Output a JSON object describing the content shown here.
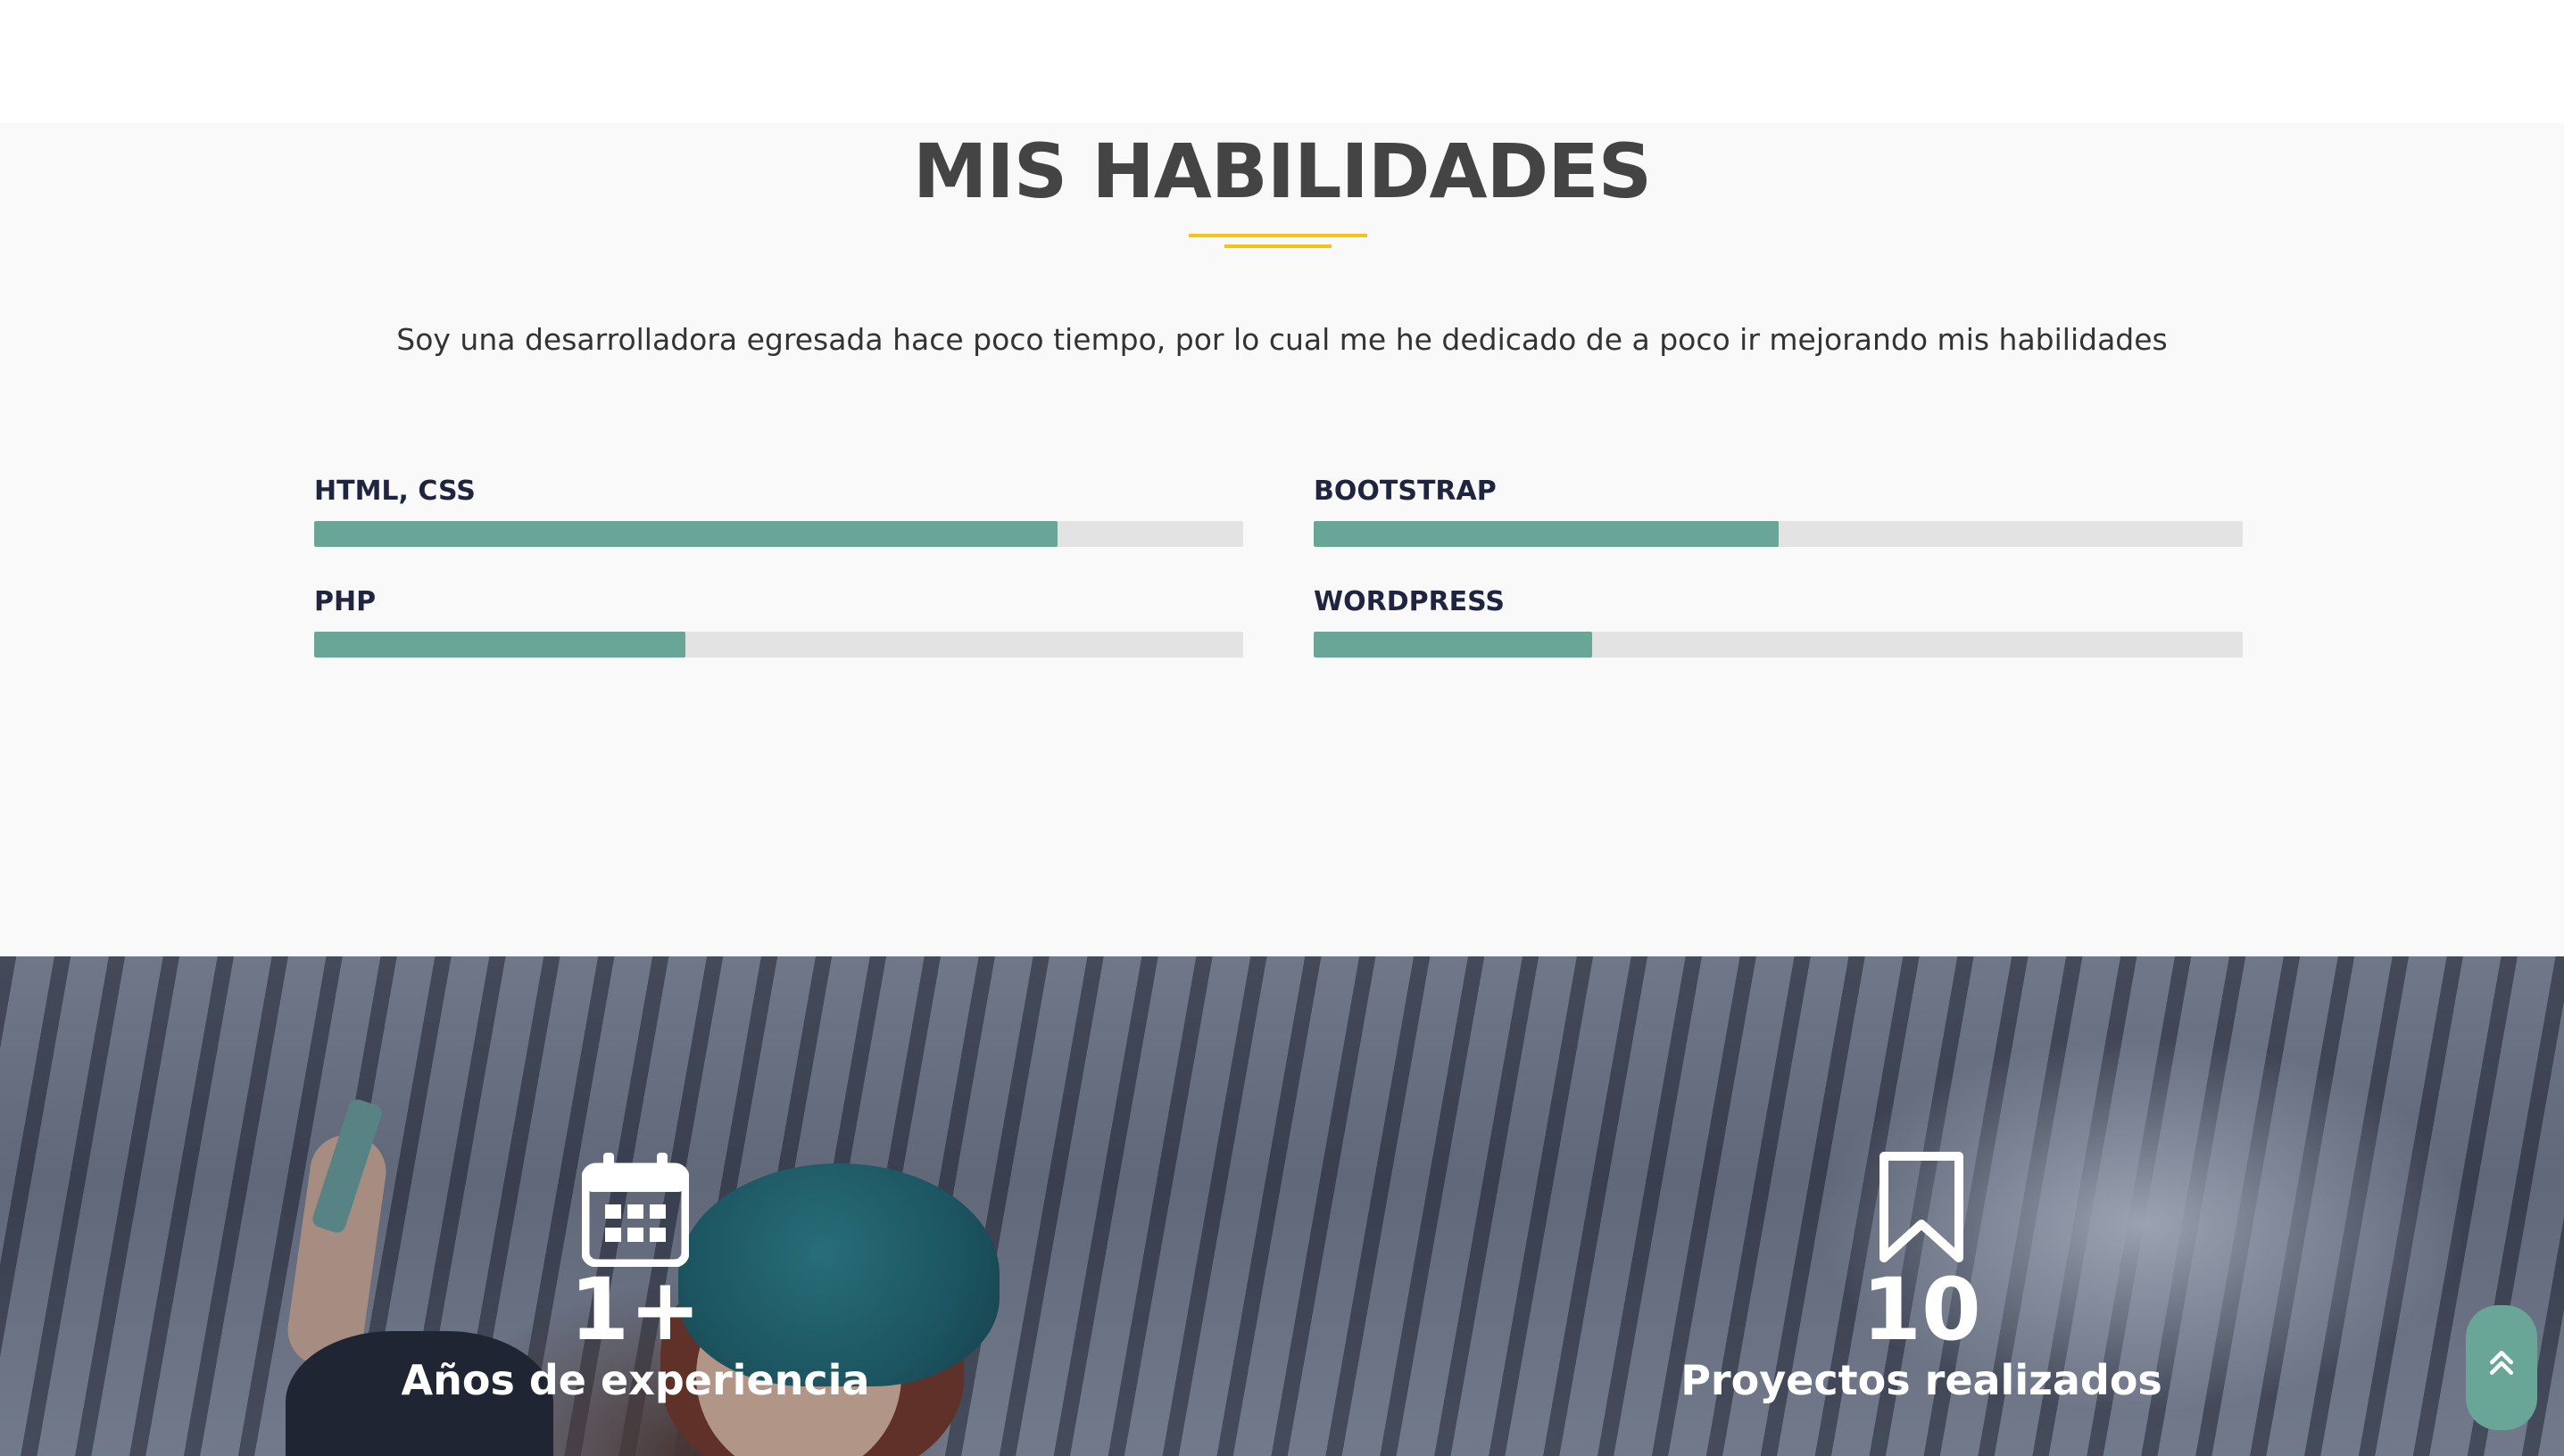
{
  "skills": {
    "title": "MIS HABILIDADES",
    "intro": "Soy una desarrolladora egresada hace poco tiempo, por lo cual me he dedicado de a poco ir mejorando mis habilidades",
    "items": [
      {
        "label": "HTML, CSS",
        "level_percent": 80
      },
      {
        "label": "BOOTSTRAP",
        "level_percent": 50
      },
      {
        "label": "PHP",
        "level_percent": 40
      },
      {
        "label": "WORDPRESS",
        "level_percent": 30
      }
    ],
    "colors": {
      "fill": "#6aa698",
      "track": "#e3e3e3",
      "accent": "#f0c419"
    }
  },
  "stats": [
    {
      "icon": "calendar-icon",
      "number": "1+",
      "label": "Años de experiencia"
    },
    {
      "icon": "bookmark-icon",
      "number": "10",
      "label": "Proyectos realizados"
    }
  ],
  "back_to_top": {
    "icon": "double-chevron-up-icon"
  }
}
